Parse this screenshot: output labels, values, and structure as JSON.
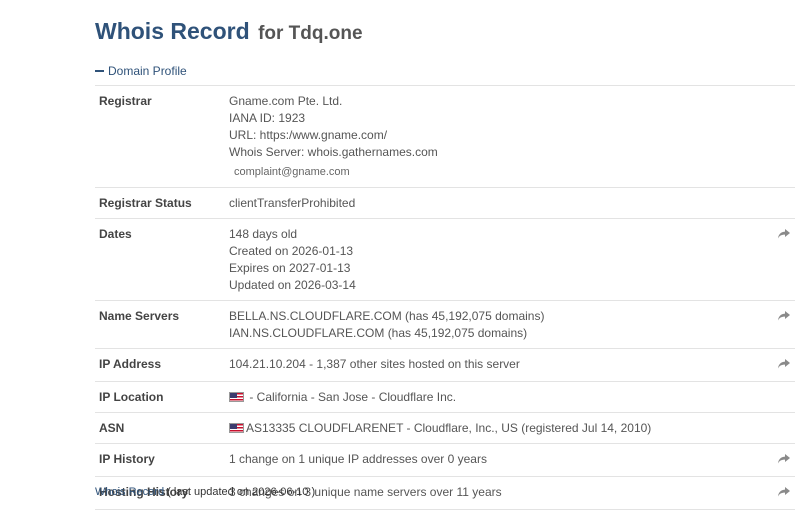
{
  "header": {
    "title": "Whois Record",
    "subtitle": "for Tdq.one"
  },
  "section": {
    "toggle_label": "Domain Profile"
  },
  "rows": {
    "registrar": {
      "label": "Registrar",
      "lines": [
        "Gname.com Pte. Ltd.",
        "IANA ID: 1923",
        "URL: https:/www.gname.com/",
        "Whois Server: whois.gathernames.com"
      ],
      "email": "complaint@gname.com"
    },
    "status": {
      "label": "Registrar Status",
      "value": "clientTransferProhibited"
    },
    "dates": {
      "label": "Dates",
      "lines": [
        "148 days old",
        "Created on 2026-01-13",
        "Expires on 2027-01-13",
        "Updated on 2026-03-14"
      ]
    },
    "nameservers": {
      "label": "Name Servers",
      "lines": [
        "BELLA.NS.CLOUDFLARE.COM (has 45,192,075 domains)",
        "IAN.NS.CLOUDFLARE.COM (has 45,192,075 domains)"
      ]
    },
    "ip_address": {
      "label": "IP Address",
      "value": "104.21.10.204 - 1,387 other sites hosted on this server"
    },
    "ip_location": {
      "label": "IP Location",
      "value": "- California - San Jose - Cloudflare Inc."
    },
    "asn": {
      "label": "ASN",
      "value": "AS13335 CLOUDFLARENET - Cloudflare, Inc., US (registered Jul 14, 2010)"
    },
    "ip_history": {
      "label": "IP History",
      "value": "1 change on 1 unique IP addresses over 0 years"
    },
    "hosting_history": {
      "label": "Hosting History",
      "value": "3 changes on 3 unique name servers over 11 years"
    }
  },
  "footer": {
    "link": "Whois Record",
    "note": "( last updated on 2026-06-10 )"
  },
  "icons": {
    "share": "share-arrow-icon",
    "flag": "us-flag-icon"
  },
  "colors": {
    "title": "#2f5279",
    "link": "#2f5279",
    "icon": "#8a8a8a"
  }
}
